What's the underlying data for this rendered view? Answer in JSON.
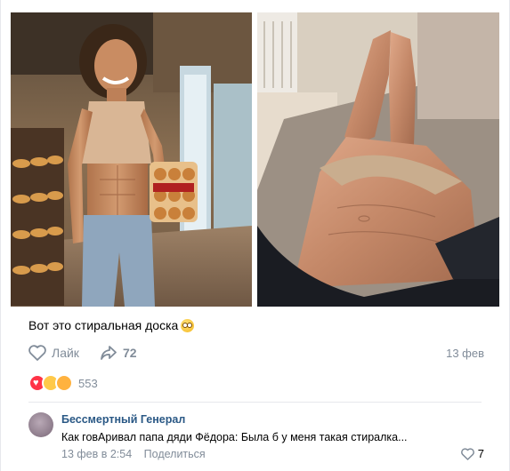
{
  "post": {
    "text": "Вот это стиральная доска",
    "emoji": "flushed-face-emoji",
    "like_label": "Лайк",
    "share_count": "72",
    "date": "13 фев",
    "reactions_count": "553",
    "reactions": [
      "heart",
      "laughing",
      "heart-eyes"
    ]
  },
  "comment": {
    "author": "Бессмертный Генерал",
    "text": "Как говАривал папа дяди Фёдора: Была б у меня такая стиралка...",
    "date": "13 фев в 2:54",
    "share_label": "Поделиться",
    "like_count": "7"
  },
  "colors": {
    "link": "#2a5885",
    "muted": "#818c99",
    "divider": "#e7e8ec"
  }
}
